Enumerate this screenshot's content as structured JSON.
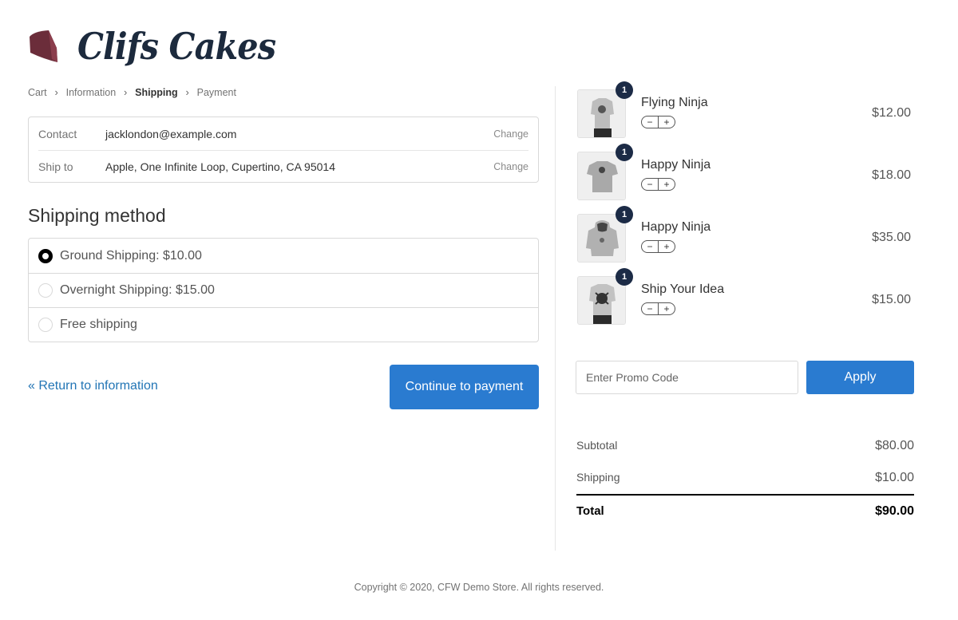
{
  "brand": {
    "name": "Clifs Cakes",
    "logo_icon": "cake-slice-icon",
    "logo_color": "#6b2d3a"
  },
  "breadcrumb": [
    {
      "label": "Cart",
      "active": false
    },
    {
      "label": "Information",
      "active": false
    },
    {
      "label": "Shipping",
      "active": true
    },
    {
      "label": "Payment",
      "active": false
    }
  ],
  "review": {
    "contact_label": "Contact",
    "contact_value": "jacklondon@example.com",
    "ship_to_label": "Ship to",
    "ship_to_value": "Apple, One Infinite Loop, Cupertino, CA 95014",
    "change_label": "Change"
  },
  "shipping_method": {
    "title": "Shipping method",
    "options": [
      {
        "label": "Ground Shipping: $10.00",
        "selected": true
      },
      {
        "label": "Overnight Shipping: $15.00",
        "selected": false
      },
      {
        "label": "Free shipping",
        "selected": false
      }
    ]
  },
  "nav": {
    "return_label": "« Return to information",
    "continue_label": "Continue to payment"
  },
  "cart": {
    "items": [
      {
        "name": "Flying Ninja",
        "qty": "1",
        "price": "$12.00",
        "thumb_icon": "tshirt-photo-icon"
      },
      {
        "name": "Happy Ninja",
        "qty": "1",
        "price": "$18.00",
        "thumb_icon": "tshirt-icon"
      },
      {
        "name": "Happy Ninja",
        "qty": "1",
        "price": "$35.00",
        "thumb_icon": "hoodie-icon"
      },
      {
        "name": "Ship Your Idea",
        "qty": "1",
        "price": "$15.00",
        "thumb_icon": "tshirt-photo-icon"
      }
    ],
    "stepper_minus": "−",
    "stepper_plus": "+"
  },
  "promo": {
    "placeholder": "Enter Promo Code",
    "apply_label": "Apply"
  },
  "totals": {
    "subtotal_label": "Subtotal",
    "subtotal_value": "$80.00",
    "shipping_label": "Shipping",
    "shipping_value": "$10.00",
    "total_label": "Total",
    "total_value": "$90.00"
  },
  "footer": {
    "text": "Copyright © 2020, CFW Demo Store. All rights reserved."
  },
  "colors": {
    "accent": "#2a7bd0",
    "link": "#2275b5",
    "badge": "#1c2b46",
    "brand_text": "#1c2a3d"
  }
}
